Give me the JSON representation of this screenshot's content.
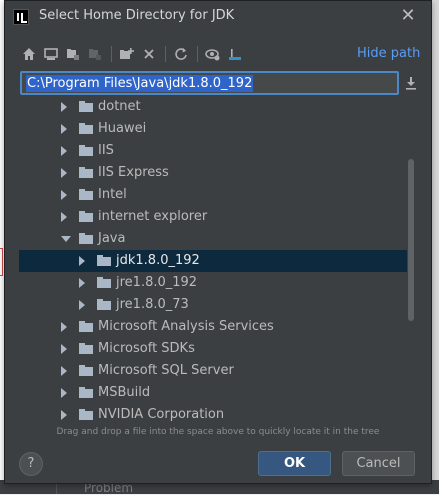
{
  "dialog": {
    "title": "Select Home Directory for JDK",
    "close_icon": "close-icon",
    "hide_path_label": "Hide path",
    "path_value": "C:\\Program Files\\Java\\jdk1.8.0_192",
    "hint": "Drag and drop a file into the space above to quickly locate it in the tree",
    "ok_label": "OK",
    "cancel_label": "Cancel",
    "help_label": "?"
  },
  "toolbar": {
    "icons": [
      "home-icon",
      "desktop-icon",
      "project-icon",
      "module-icon",
      "new-folder-icon",
      "delete-icon",
      "refresh-icon",
      "show-hidden-icon",
      "collapse-icon"
    ]
  },
  "tree": {
    "rows": [
      {
        "label": "dotnet",
        "depth": 0,
        "expanded": false,
        "selected": false
      },
      {
        "label": "Huawei",
        "depth": 0,
        "expanded": false,
        "selected": false
      },
      {
        "label": "IIS",
        "depth": 0,
        "expanded": false,
        "selected": false
      },
      {
        "label": "IIS Express",
        "depth": 0,
        "expanded": false,
        "selected": false
      },
      {
        "label": "Intel",
        "depth": 0,
        "expanded": false,
        "selected": false
      },
      {
        "label": "internet explorer",
        "depth": 0,
        "expanded": false,
        "selected": false
      },
      {
        "label": "Java",
        "depth": 0,
        "expanded": true,
        "selected": false
      },
      {
        "label": "jdk1.8.0_192",
        "depth": 1,
        "expanded": false,
        "selected": true
      },
      {
        "label": "jre1.8.0_192",
        "depth": 1,
        "expanded": false,
        "selected": false
      },
      {
        "label": "jre1.8.0_73",
        "depth": 1,
        "expanded": false,
        "selected": false
      },
      {
        "label": "Microsoft Analysis Services",
        "depth": 0,
        "expanded": false,
        "selected": false
      },
      {
        "label": "Microsoft SDKs",
        "depth": 0,
        "expanded": false,
        "selected": false
      },
      {
        "label": "Microsoft SQL Server",
        "depth": 0,
        "expanded": false,
        "selected": false
      },
      {
        "label": "MSBuild",
        "depth": 0,
        "expanded": false,
        "selected": false
      },
      {
        "label": "NVIDIA Corporation",
        "depth": 0,
        "expanded": false,
        "selected": false
      }
    ]
  },
  "background": {
    "bottom_text": "Problem"
  },
  "colors": {
    "dialog_bg": "#3c3f41",
    "selection": "#0d293e",
    "link": "#589df6",
    "ok_button": "#365880",
    "path_highlight": "#2f65ca"
  }
}
